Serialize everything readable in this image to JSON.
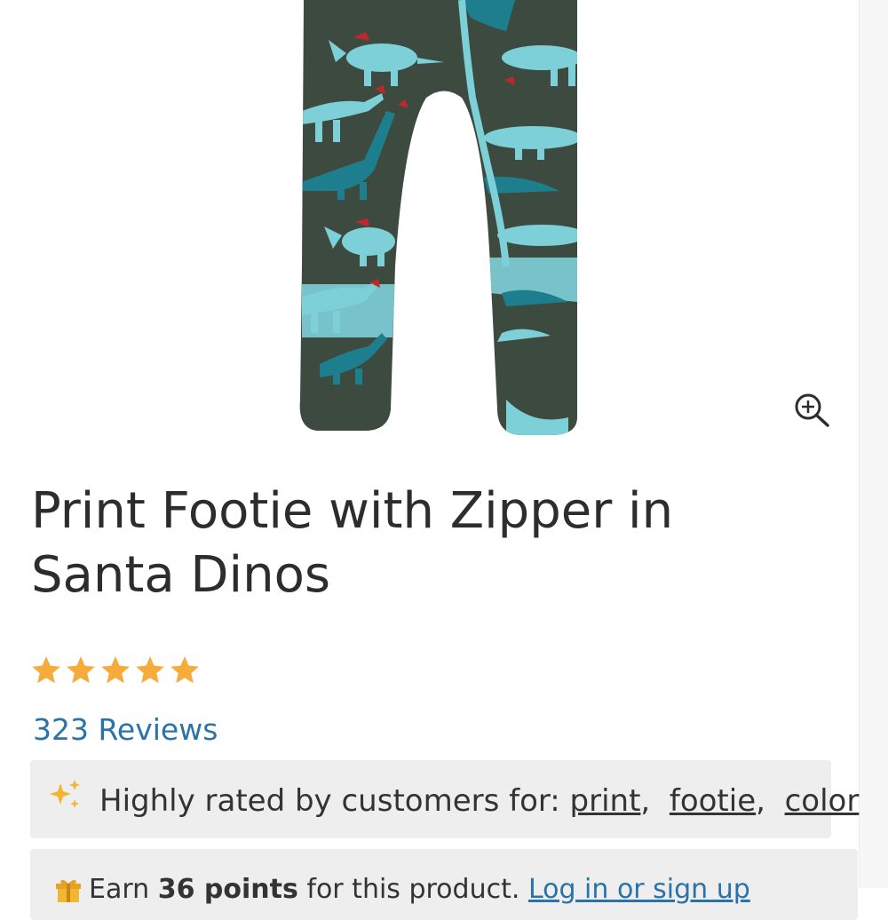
{
  "product": {
    "title": "Print Footie with Zipper in Santa Dinos",
    "rating": 5,
    "rating_max": 5,
    "reviews_label": "323 Reviews"
  },
  "highlights": {
    "prefix": "Highly rated by customers for:",
    "tags": [
      "print",
      "footie",
      "color"
    ]
  },
  "rewards": {
    "earn": "Earn",
    "points": "36 points",
    "suffix": "for this product.",
    "login_link": "Log in or sign up"
  },
  "icons": {
    "zoom": "zoom-in-icon",
    "star": "star-icon",
    "sparkle": "sparkle-icon",
    "gift": "gift-icon"
  },
  "colors": {
    "star": "#f5ac3c",
    "link": "#2a73a8",
    "fabric": "#3d4a40",
    "dino_light": "#7ed0d8",
    "dino_dark": "#1d7f8e",
    "sparkle": "#f2b632"
  }
}
